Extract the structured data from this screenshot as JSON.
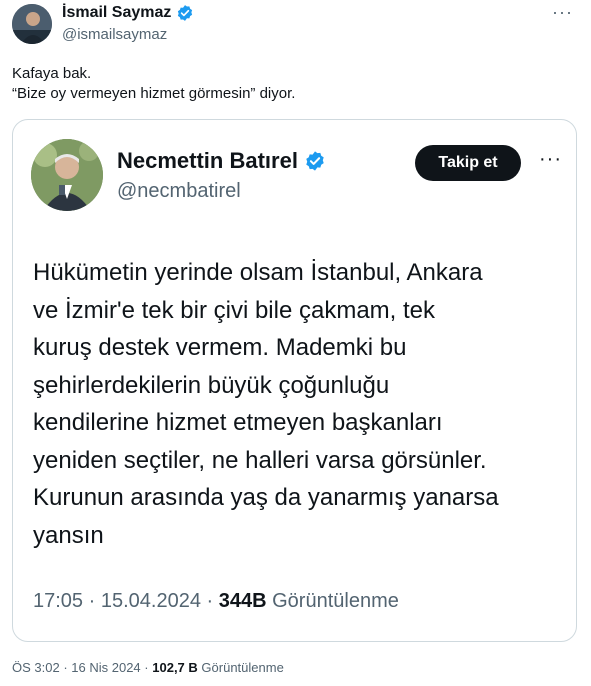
{
  "tweet": {
    "author_name": "İsmail Saymaz",
    "author_handle": "@ismailsaymaz",
    "text_lines": [
      "Kafaya bak.",
      "“Bize oy vermeyen hizmet görmesin” diyor."
    ],
    "time": "ÖS 3:02",
    "date": "16 Nis 2024",
    "views_count": "102,7 B",
    "views_label": "Görüntülenme",
    "more_label": "···"
  },
  "quote": {
    "author_name": "Necmettin Batırel",
    "author_handle": "@necmbatirel",
    "follow_label": "Takip et",
    "more_label": "···",
    "text_lines": [
      "Hükümetin yerinde olsam İstanbul, Ankara",
      "ve İzmir'e tek bir çivi bile çakmam, tek",
      "kuruş destek vermem. Mademki bu",
      "şehirlerdekilerin büyük çoğunluğu",
      "kendilerine hizmet etmeyen başkanları",
      "yeniden seçtiler, ne halleri varsa görsünler.",
      "Kurunun arasında yaş da yanarmış yanarsa",
      "yansın"
    ],
    "time": "17:05",
    "date": "15.04.2024",
    "views_count": "344B",
    "views_label": "Görüntülenme"
  },
  "colors": {
    "verified": "#1d9bf0",
    "text": "#0f1419",
    "muted": "#536471",
    "border": "#cfd9de"
  }
}
